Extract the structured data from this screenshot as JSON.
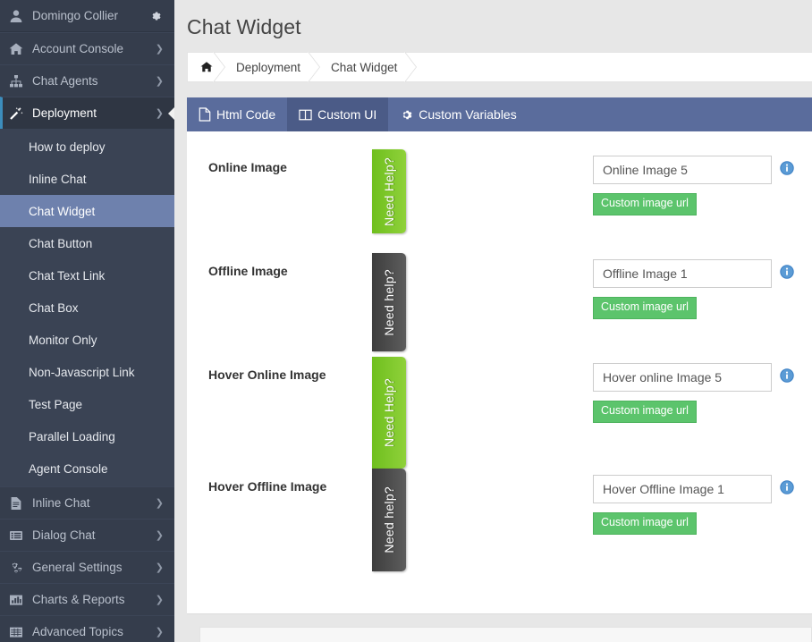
{
  "sidebar": {
    "user": {
      "name": "Domingo Collier",
      "avatar_icon": "user-icon",
      "settings_icon": "gear-icon"
    },
    "items": [
      {
        "label": "Account Console",
        "icon": "home-icon",
        "chevron": "❯",
        "open": false
      },
      {
        "label": "Chat Agents",
        "icon": "sitemap-icon",
        "chevron": "❯",
        "open": false
      },
      {
        "label": "Deployment",
        "icon": "magic-wand-icon",
        "chevron": "❯",
        "open": true
      },
      {
        "label": "Inline Chat",
        "icon": "file-text-icon",
        "chevron": "❯",
        "open": false
      },
      {
        "label": "Dialog Chat",
        "icon": "list-icon",
        "chevron": "❯",
        "open": false
      },
      {
        "label": "General Settings",
        "icon": "gears-icon",
        "chevron": "❯",
        "open": false
      },
      {
        "label": "Charts & Reports",
        "icon": "bar-chart-icon",
        "chevron": "❯",
        "open": false
      },
      {
        "label": "Advanced Topics",
        "icon": "table-icon",
        "chevron": "❯",
        "open": false
      }
    ],
    "submenu": [
      {
        "label": "How to deploy",
        "active": false
      },
      {
        "label": "Inline Chat",
        "active": false
      },
      {
        "label": "Chat Widget",
        "active": true
      },
      {
        "label": "Chat Button",
        "active": false
      },
      {
        "label": "Chat Text Link",
        "active": false
      },
      {
        "label": "Chat Box",
        "active": false
      },
      {
        "label": "Monitor Only",
        "active": false
      },
      {
        "label": "Non-Javascript Link",
        "active": false
      },
      {
        "label": "Test Page",
        "active": false
      },
      {
        "label": "Parallel Loading",
        "active": false
      },
      {
        "label": "Agent Console",
        "active": false
      }
    ]
  },
  "header": {
    "title": "Chat Widget",
    "breadcrumb": [
      {
        "label": "",
        "icon": "home-icon"
      },
      {
        "label": "Deployment",
        "icon": ""
      },
      {
        "label": "Chat Widget",
        "icon": ""
      }
    ]
  },
  "tabs": [
    {
      "label": "Html Code",
      "icon": "file-icon",
      "active": false
    },
    {
      "label": "Custom UI",
      "icon": "columns-icon",
      "active": true
    },
    {
      "label": "Custom Variables",
      "icon": "gear-icon",
      "active": false
    }
  ],
  "form": {
    "button_label": "Custom image url",
    "info_icon": "info-circle-icon",
    "rows": [
      {
        "label": "Online Image",
        "preview": {
          "text": "Need Help?",
          "style": "green"
        },
        "value": "Online Image 5",
        "placeholder": "Online Image 5"
      },
      {
        "label": "Offline Image",
        "preview": {
          "text": "Need help?",
          "style": "dark"
        },
        "value": "Offline Image 1",
        "placeholder": "Offline Image 1"
      },
      {
        "label": "Hover Online Image",
        "preview": {
          "text": "Need Help?",
          "style": "green"
        },
        "value": "Hover online Image 5",
        "placeholder": "Hover online Image 5"
      },
      {
        "label": "Hover Offline Image",
        "preview": {
          "text": "Need help?",
          "style": "dark"
        },
        "value": "Hover Offline Image 1",
        "placeholder": "Hover Offline Image 1"
      }
    ]
  },
  "colors": {
    "sidebar_bg": "#353d4c",
    "submenu_bg": "#3a4354",
    "submenu_active": "#6e81ad",
    "tabbar": "#5a6c9c",
    "tab_active": "#4b5b87",
    "green_button": "#5cc46c",
    "widget_green": "#7fc926",
    "widget_dark": "#4a4a4a",
    "info_blue": "#3b7fc4",
    "page_bg": "#e7e7e7"
  }
}
